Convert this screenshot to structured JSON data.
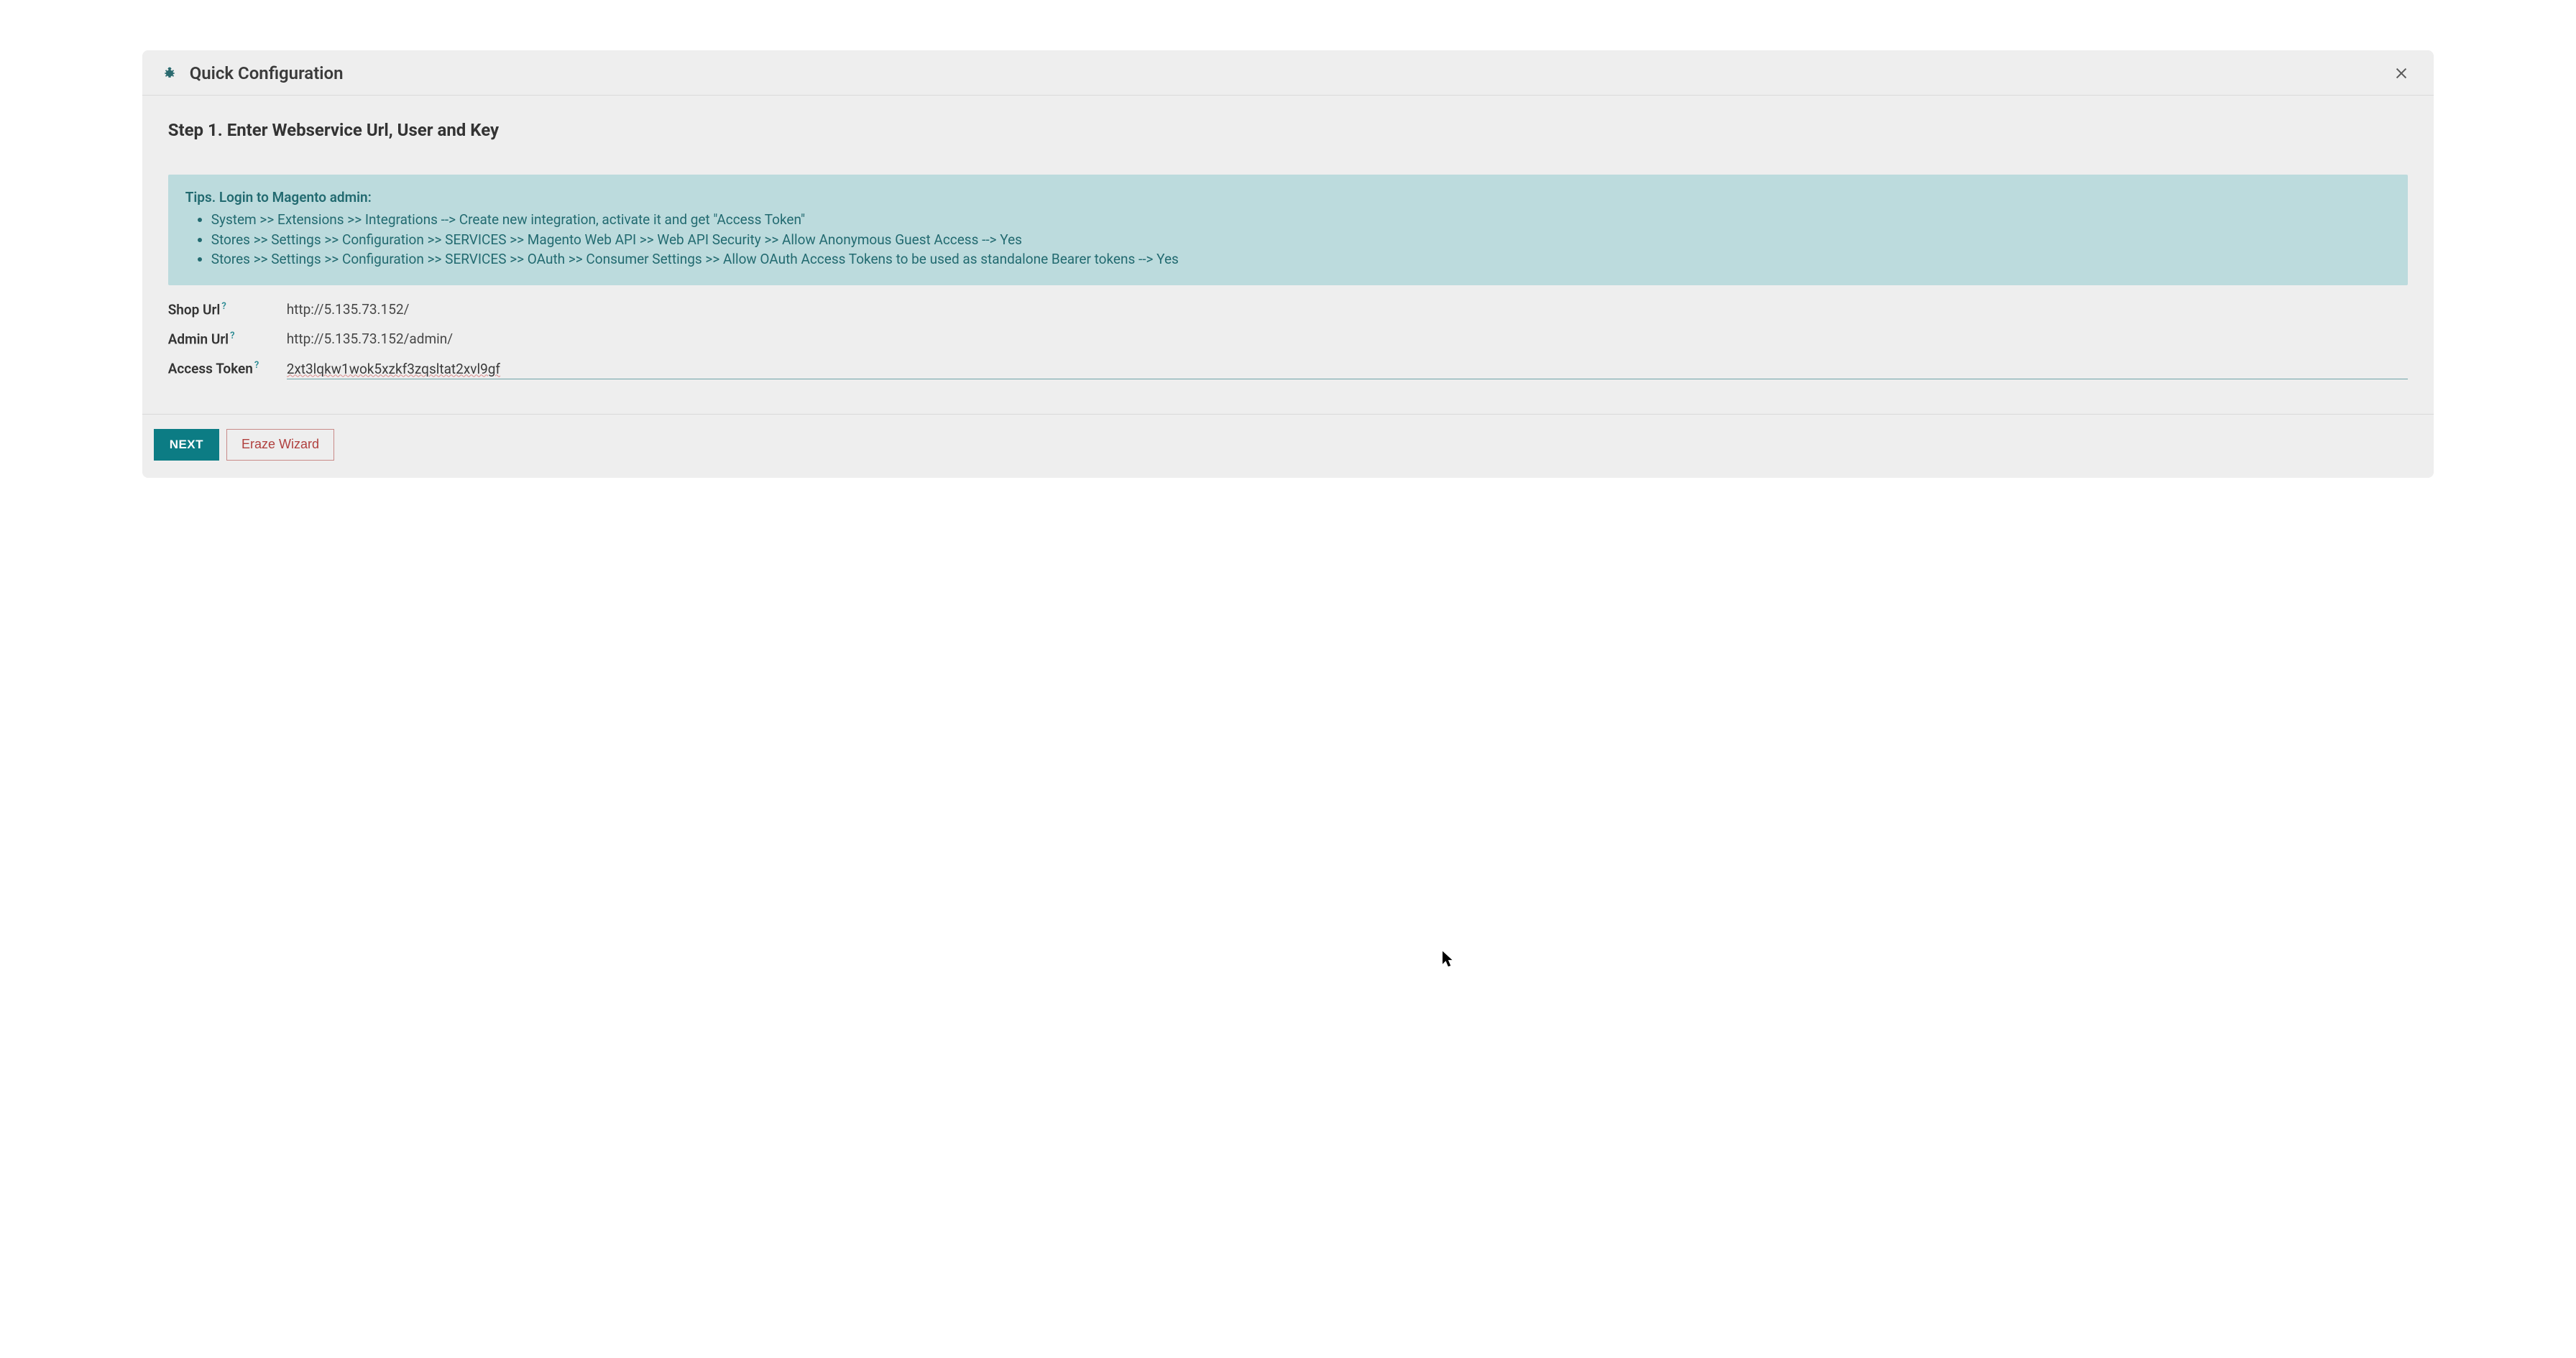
{
  "dialog": {
    "title": "Quick Configuration",
    "step_heading": "Step 1. Enter Webservice Url, User and Key"
  },
  "tips": {
    "title": "Tips. Login to Magento admin:",
    "items": [
      "System >> Extensions >> Integrations --> Create new integration, activate it and get \"Access Token\"",
      "Stores >> Settings >> Configuration >> SERVICES >> Magento Web API >> Web API Security >> Allow Anonymous Guest Access --> Yes",
      "Stores >> Settings >> Configuration >> SERVICES >> OAuth >> Consumer Settings >> Allow OAuth Access Tokens to be used as standalone Bearer tokens --> Yes"
    ]
  },
  "fields": {
    "shop_url": {
      "label": "Shop Url",
      "value": "http://5.135.73.152/"
    },
    "admin_url": {
      "label": "Admin Url",
      "value": "http://5.135.73.152/admin/"
    },
    "access_token": {
      "label": "Access Token",
      "value": "2xt3lqkw1wok5xzkf3zqsltat2xvl9gf"
    }
  },
  "help_marker": "?",
  "footer": {
    "next": "NEXT",
    "eraze": "Eraze Wizard"
  }
}
